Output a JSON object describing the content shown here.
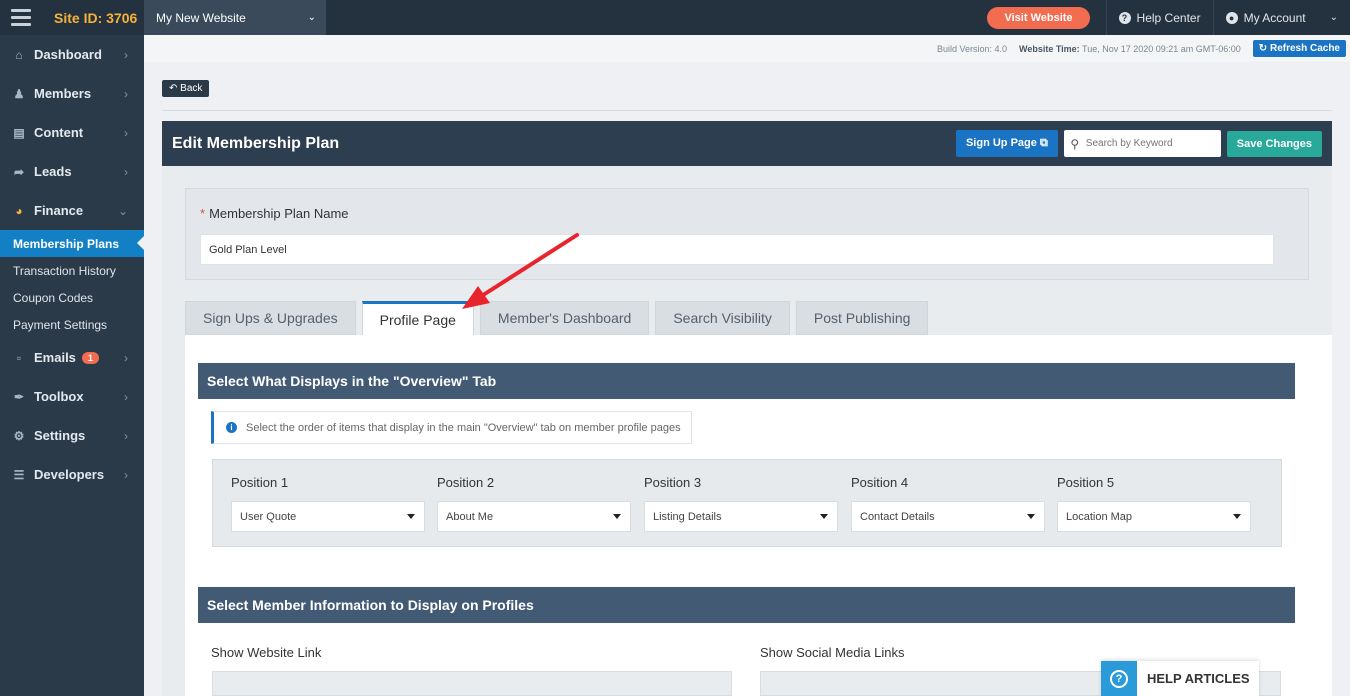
{
  "topbar": {
    "site_id": "Site ID: 3706",
    "site_select": "My New Website",
    "visit_website": "Visit Website",
    "help_center": "Help Center",
    "my_account": "My Account"
  },
  "sidebar": {
    "items": [
      {
        "label": "Dashboard",
        "icon": "home-icon"
      },
      {
        "label": "Members",
        "icon": "users-icon"
      },
      {
        "label": "Content",
        "icon": "folder-icon"
      },
      {
        "label": "Leads",
        "icon": "share-icon"
      },
      {
        "label": "Finance",
        "icon": "pie-chart-icon"
      }
    ],
    "finance_sub": [
      "Membership Plans",
      "Transaction History",
      "Coupon Codes",
      "Payment Settings"
    ],
    "items_after": [
      {
        "label": "Emails",
        "icon": "inbox-icon",
        "badge": "1"
      },
      {
        "label": "Toolbox",
        "icon": "wrench-icon"
      },
      {
        "label": "Settings",
        "icon": "gear-icon"
      },
      {
        "label": "Developers",
        "icon": "sliders-icon"
      }
    ]
  },
  "buildbar": {
    "build_version": "Build Version: 4.0",
    "website_time_label": "Website Time:",
    "website_time_value": "Tue, Nov 17 2020 09:21 am GMT-06:00",
    "refresh_cache": "Refresh Cache"
  },
  "back_label": "Back",
  "panel": {
    "title": "Edit Membership Plan",
    "signup_page": "Sign Up Page",
    "search_placeholder": "Search by Keyword",
    "save_changes": "Save Changes"
  },
  "plan_name": {
    "label": "Membership Plan Name",
    "value": "Gold Plan Level"
  },
  "tabs": [
    "Sign Ups & Upgrades",
    "Profile Page",
    "Member's Dashboard",
    "Search Visibility",
    "Post Publishing"
  ],
  "overview": {
    "header": "Select What Displays in the \"Overview\" Tab",
    "info": "Select the order of items that display in the main \"Overview\" tab on member profile pages",
    "positions": [
      {
        "label": "Position 1",
        "value": "User Quote"
      },
      {
        "label": "Position 2",
        "value": "About Me"
      },
      {
        "label": "Position 3",
        "value": "Listing Details"
      },
      {
        "label": "Position 4",
        "value": "Contact Details"
      },
      {
        "label": "Position 5",
        "value": "Location Map"
      }
    ]
  },
  "member_info": {
    "header": "Select Member Information to Display on Profiles",
    "show_website_link": "Show Website Link",
    "show_social_links": "Show Social Media Links"
  },
  "help_articles": "HELP ARTICLES",
  "colors": {
    "topbar": "#243240",
    "sidebar": "#2b3a49",
    "active_blue": "#1a73c3",
    "visit_orange": "#f26c4f",
    "save_teal": "#28a99a",
    "section_header": "#435a75",
    "annotation_red": "#e8242c"
  }
}
